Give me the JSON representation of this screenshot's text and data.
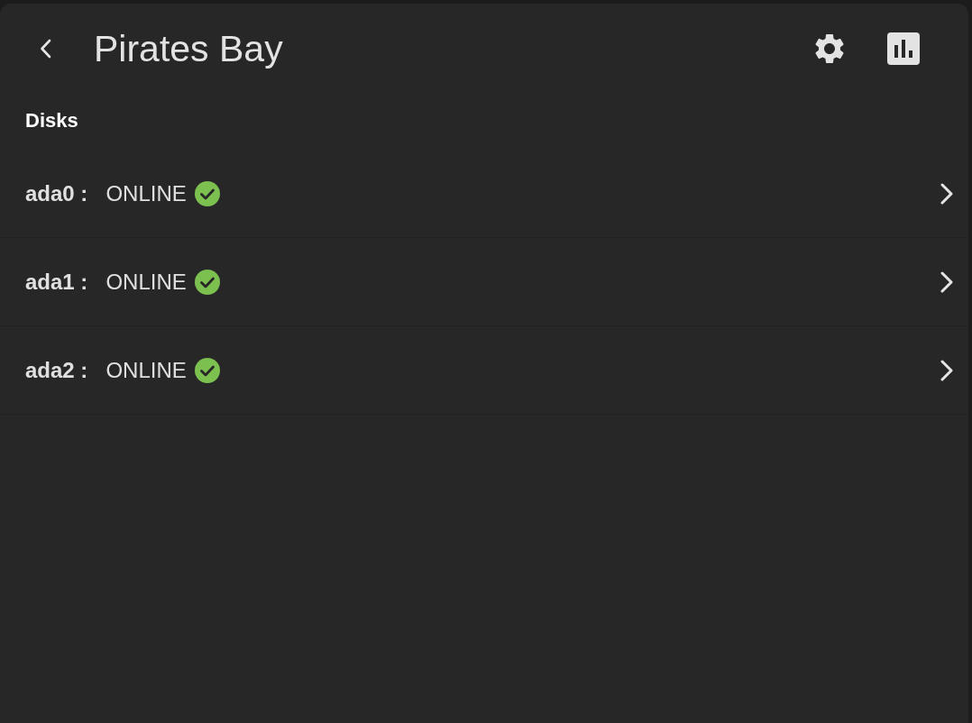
{
  "header": {
    "title": "Pirates Bay"
  },
  "section": {
    "title": "Disks"
  },
  "disks": [
    {
      "name": "ada0 :",
      "status": "ONLINE",
      "healthy": true
    },
    {
      "name": "ada1 :",
      "status": "ONLINE",
      "healthy": true
    },
    {
      "name": "ada2 :",
      "status": "ONLINE",
      "healthy": true
    }
  ]
}
